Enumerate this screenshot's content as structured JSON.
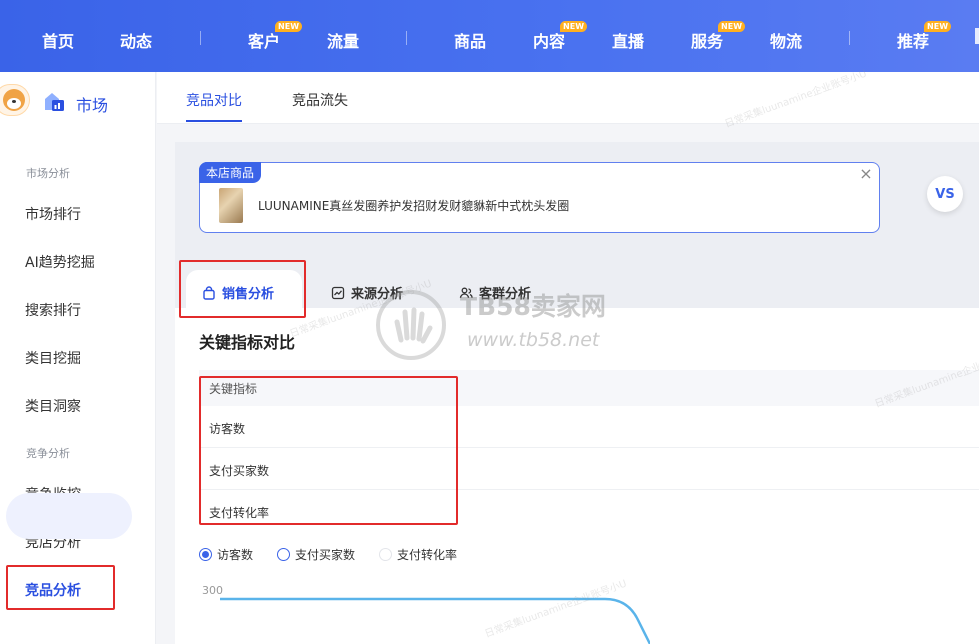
{
  "topnav": {
    "items": [
      {
        "label": "首页",
        "badge": ""
      },
      {
        "label": "动态",
        "badge": ""
      },
      {
        "label": "客户",
        "badge": "NEW"
      },
      {
        "label": "流量",
        "badge": ""
      },
      {
        "label": "商品",
        "badge": ""
      },
      {
        "label": "内容",
        "badge": "NEW"
      },
      {
        "label": "直播",
        "badge": ""
      },
      {
        "label": "服务",
        "badge": "NEW"
      },
      {
        "label": "物流",
        "badge": ""
      },
      {
        "label": "推荐",
        "badge": "NEW"
      }
    ]
  },
  "sidebar": {
    "title": "市场",
    "sections": [
      {
        "title": "市场分析",
        "items": [
          "市场排行",
          "AI趋势挖掘",
          "搜索排行",
          "类目挖掘",
          "类目洞察"
        ]
      },
      {
        "title": "竞争分析",
        "items": [
          "竞争监控",
          "竞店分析",
          "竞品分析"
        ]
      }
    ],
    "active_item": "竞品分析"
  },
  "tabs": [
    "竞品对比",
    "竞品流失"
  ],
  "compare": {
    "tag": "本店商品",
    "product_name": "LUUNAMINE真丝发圈养护发招财发财貔貅新中式枕头发圈",
    "vs_label": "VS"
  },
  "analysis_tabs": [
    "销售分析",
    "来源分析",
    "客群分析"
  ],
  "main": {
    "section_title": "关键指标对比",
    "metrics_header": "关键指标",
    "metrics": [
      "访客数",
      "支付买家数",
      "支付转化率"
    ],
    "radios": [
      {
        "label": "访客数",
        "checked": true
      },
      {
        "label": "支付买家数",
        "checked": false
      },
      {
        "label": "支付转化率",
        "checked": false
      }
    ],
    "y_tick": "300"
  },
  "watermark": {
    "main": "TB58卖家网",
    "sub": "www.tb58.net",
    "faint": "日常采集luunamine企业账号小U"
  },
  "colors": {
    "brand_blue": "#3a63e8",
    "annotation_red": "#e22b2b",
    "chart_line": "#5ab4ea"
  }
}
